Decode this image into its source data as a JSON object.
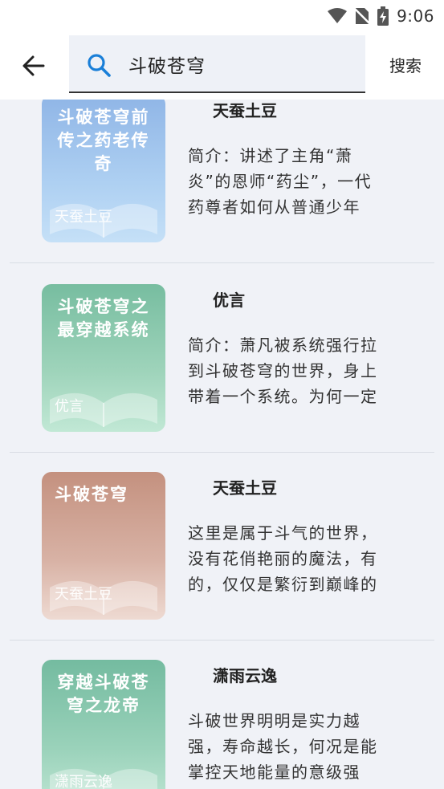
{
  "status_bar": {
    "time": "9:06",
    "icons": [
      "wifi-icon",
      "no-sim-icon",
      "battery-charging-icon"
    ]
  },
  "header": {
    "back_icon": "arrow-left-icon",
    "search_icon": "search-icon",
    "search_value": "斗破苍穹",
    "search_button": "搜索"
  },
  "colors": {
    "accent": "#1a7fd8",
    "background": "#f0f2f7"
  },
  "results": [
    {
      "cover_title": "斗破苍穹前传之药老传奇",
      "cover_author": "天蚕土豆",
      "author": "天蚕土豆",
      "description": "简介：讲述了主角“萧炎”的恩师“药尘”，一代药尊者如何从普通少年",
      "cover_color": [
        "#8fb8e6",
        "#b7d6f3"
      ]
    },
    {
      "cover_title": "斗破苍穹之最穿越系统",
      "cover_author": "优言",
      "author": "优言",
      "description": "简介：萧凡被系统强行拉到斗破苍穹的世界，身上带着一个系统。为何一定",
      "cover_color": [
        "#7ec2a5",
        "#b6e2cc"
      ]
    },
    {
      "cover_title": "斗破苍穹",
      "cover_author": "天蚕土豆",
      "author": "天蚕土豆",
      "description": "这里是属于斗气的世界，没有花俏艳丽的魔法，有的，仅仅是繁衍到巅峰的",
      "cover_color": [
        "#c9998a",
        "#ead2c9"
      ]
    },
    {
      "cover_title": "穿越斗破苍穹之龙帝",
      "cover_author": "潇雨云逸",
      "author": "潇雨云逸",
      "description": "斗破世界明明是实力越强，寿命越长，何况是能掌控天地能量的意级强",
      "cover_color": [
        "#7cc0a6",
        "#b4e0cd"
      ]
    }
  ]
}
